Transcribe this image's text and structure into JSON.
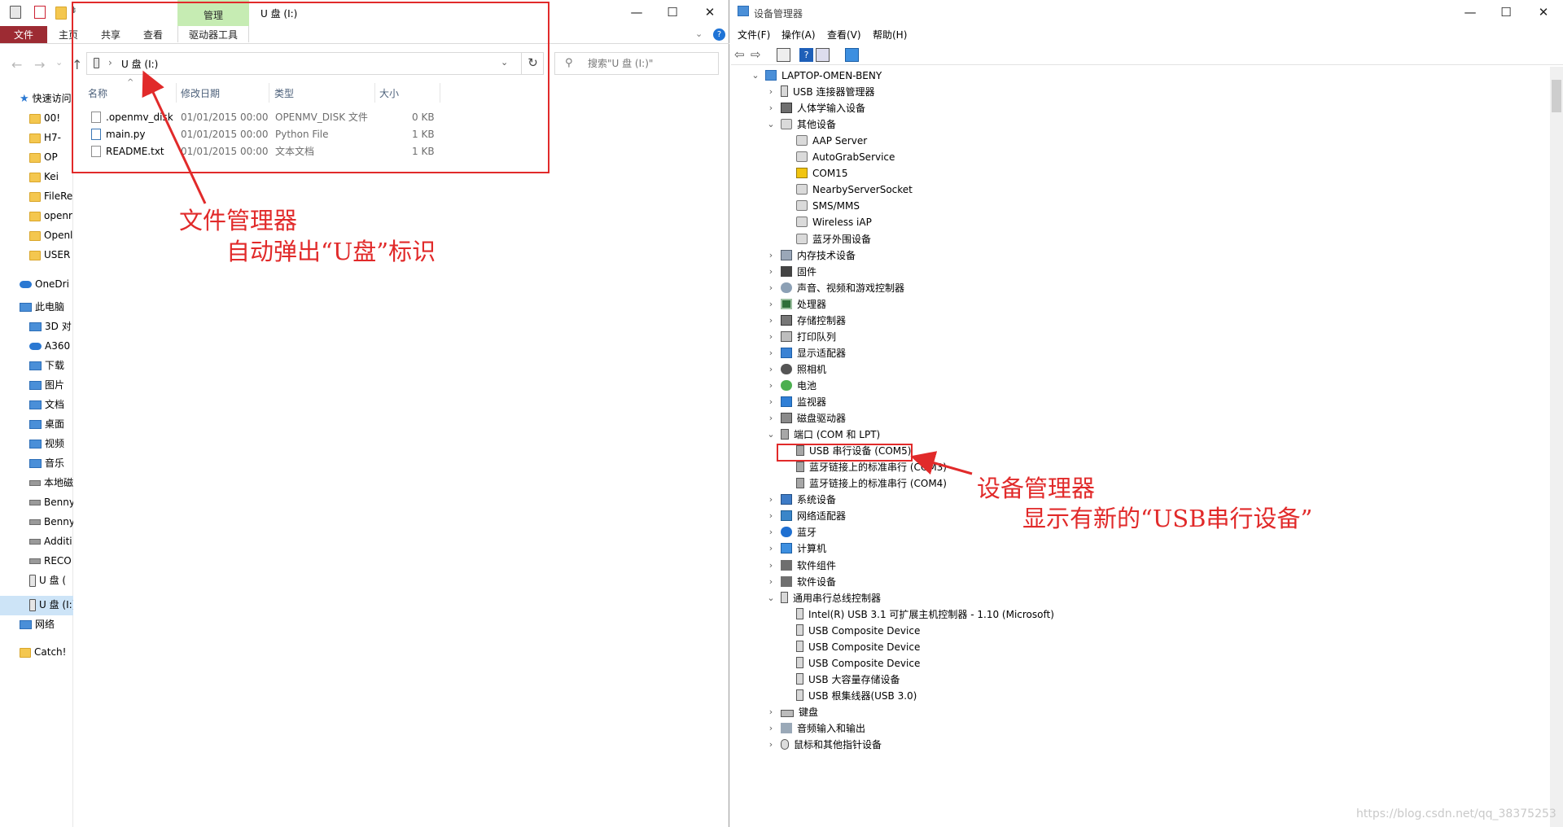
{
  "explorer": {
    "title": "U 盘 (I:)",
    "contextual_tab_header": "管理",
    "tabs": {
      "file": "文件",
      "home": "主页",
      "share": "共享",
      "view": "查看",
      "drive_tools": "驱动器工具"
    },
    "address": {
      "crumb": "U 盘 (I:)"
    },
    "search_placeholder": "搜索\"U 盘 (I:)\"",
    "columns": {
      "name": "名称",
      "modified": "修改日期",
      "type": "类型",
      "size": "大小"
    },
    "files": [
      {
        "name": ".openmv_disk",
        "modified": "01/01/2015 00:00",
        "type": "OPENMV_DISK 文件",
        "size": "0 KB"
      },
      {
        "name": "main.py",
        "modified": "01/01/2015 00:00",
        "type": "Python File",
        "size": "1 KB"
      },
      {
        "name": "README.txt",
        "modified": "01/01/2015 00:00",
        "type": "文本文档",
        "size": "1 KB"
      }
    ],
    "sidebar": [
      {
        "label": "快速访问",
        "icon": "star-icon"
      },
      {
        "label": "00!",
        "icon": "folder-icon"
      },
      {
        "label": "H7-",
        "icon": "folder-icon"
      },
      {
        "label": "OP",
        "icon": "folder-icon"
      },
      {
        "label": "Kei",
        "icon": "folder-icon"
      },
      {
        "label": "FileRe",
        "icon": "folder-icon"
      },
      {
        "label": "openr",
        "icon": "folder-icon"
      },
      {
        "label": "Openl",
        "icon": "folder-icon"
      },
      {
        "label": "USER",
        "icon": "folder-icon"
      },
      {
        "label": "OneDri",
        "icon": "cloud-icon"
      },
      {
        "label": "此电脑",
        "icon": "computer-icon"
      },
      {
        "label": "3D 对",
        "icon": "cube-icon"
      },
      {
        "label": "A360",
        "icon": "a360-icon"
      },
      {
        "label": "下载",
        "icon": "download-icon"
      },
      {
        "label": "图片",
        "icon": "pictures-icon"
      },
      {
        "label": "文档",
        "icon": "documents-icon"
      },
      {
        "label": "桌面",
        "icon": "desktop-icon"
      },
      {
        "label": "视频",
        "icon": "videos-icon"
      },
      {
        "label": "音乐",
        "icon": "music-icon"
      },
      {
        "label": "本地磁",
        "icon": "drive-icon"
      },
      {
        "label": "Benny",
        "icon": "drive-icon"
      },
      {
        "label": "Benny",
        "icon": "drive-icon"
      },
      {
        "label": "Additi",
        "icon": "drive-icon"
      },
      {
        "label": "RECO",
        "icon": "drive-icon"
      },
      {
        "label": "U 盘 (",
        "icon": "usb-drive-icon"
      },
      {
        "label": "U 盘 (I:)",
        "icon": "usb-drive-icon"
      },
      {
        "label": "网络",
        "icon": "network-icon"
      },
      {
        "label": "Catch!",
        "icon": "folder-icon"
      }
    ]
  },
  "annotations": {
    "explorer_line1": "文件管理器",
    "explorer_line2": "自动弹出“U盘”标识",
    "devmgr_line1": "设备管理器",
    "devmgr_line2": "显示有新的“USB串行设备”",
    "color": "#e12a2a"
  },
  "device_manager": {
    "title": "设备管理器",
    "menu": [
      "文件(F)",
      "操作(A)",
      "查看(V)",
      "帮助(H)"
    ],
    "root": "LAPTOP-OMEN-BENY",
    "tree": [
      {
        "label": "USB 连接器管理器",
        "expanded": false,
        "icon": "usb"
      },
      {
        "label": "人体学输入设备",
        "expanded": false,
        "icon": "hid"
      },
      {
        "label": "其他设备",
        "expanded": true,
        "icon": "other",
        "children": [
          {
            "label": "AAP Server",
            "icon": "other"
          },
          {
            "label": "AutoGrabService",
            "icon": "other"
          },
          {
            "label": "COM15",
            "icon": "warn"
          },
          {
            "label": "NearbyServerSocket",
            "icon": "other"
          },
          {
            "label": "SMS/MMS",
            "icon": "other"
          },
          {
            "label": "Wireless iAP",
            "icon": "other"
          },
          {
            "label": "蓝牙外围设备",
            "icon": "other"
          }
        ]
      },
      {
        "label": "内存技术设备",
        "expanded": false,
        "icon": "mem"
      },
      {
        "label": "固件",
        "expanded": false,
        "icon": "fw"
      },
      {
        "label": "声音、视频和游戏控制器",
        "expanded": false,
        "icon": "snd"
      },
      {
        "label": "处理器",
        "expanded": false,
        "icon": "cpu"
      },
      {
        "label": "存储控制器",
        "expanded": false,
        "icon": "stor"
      },
      {
        "label": "打印队列",
        "expanded": false,
        "icon": "prn"
      },
      {
        "label": "显示适配器",
        "expanded": false,
        "icon": "disp"
      },
      {
        "label": "照相机",
        "expanded": false,
        "icon": "cam"
      },
      {
        "label": "电池",
        "expanded": false,
        "icon": "bat"
      },
      {
        "label": "监视器",
        "expanded": false,
        "icon": "mon"
      },
      {
        "label": "磁盘驱动器",
        "expanded": false,
        "icon": "disk"
      },
      {
        "label": "端口 (COM 和 LPT)",
        "expanded": true,
        "icon": "port",
        "children": [
          {
            "label": "USB 串行设备 (COM5)",
            "icon": "port",
            "highlight": true
          },
          {
            "label": "蓝牙链接上的标准串行 (COM3)",
            "icon": "port"
          },
          {
            "label": "蓝牙链接上的标准串行 (COM4)",
            "icon": "port"
          }
        ]
      },
      {
        "label": "系统设备",
        "expanded": false,
        "icon": "sys"
      },
      {
        "label": "网络适配器",
        "expanded": false,
        "icon": "net"
      },
      {
        "label": "蓝牙",
        "expanded": false,
        "icon": "bt"
      },
      {
        "label": "计算机",
        "expanded": false,
        "icon": "comp"
      },
      {
        "label": "软件组件",
        "expanded": false,
        "icon": "swc"
      },
      {
        "label": "软件设备",
        "expanded": false,
        "icon": "swc"
      },
      {
        "label": "通用串行总线控制器",
        "expanded": true,
        "icon": "usb",
        "children": [
          {
            "label": "Intel(R) USB 3.1 可扩展主机控制器 - 1.10 (Microsoft)",
            "icon": "usb"
          },
          {
            "label": "USB Composite Device",
            "icon": "usb"
          },
          {
            "label": "USB Composite Device",
            "icon": "usb"
          },
          {
            "label": "USB Composite Device",
            "icon": "usb"
          },
          {
            "label": "USB 大容量存储设备",
            "icon": "usb"
          },
          {
            "label": "USB 根集线器(USB 3.0)",
            "icon": "usb"
          }
        ]
      },
      {
        "label": "键盘",
        "expanded": false,
        "icon": "kbd"
      },
      {
        "label": "音频输入和输出",
        "expanded": false,
        "icon": "aud"
      },
      {
        "label": "鼠标和其他指针设备",
        "expanded": false,
        "icon": "mouse"
      }
    ]
  },
  "watermark": "https://blog.csdn.net/qq_38375253"
}
